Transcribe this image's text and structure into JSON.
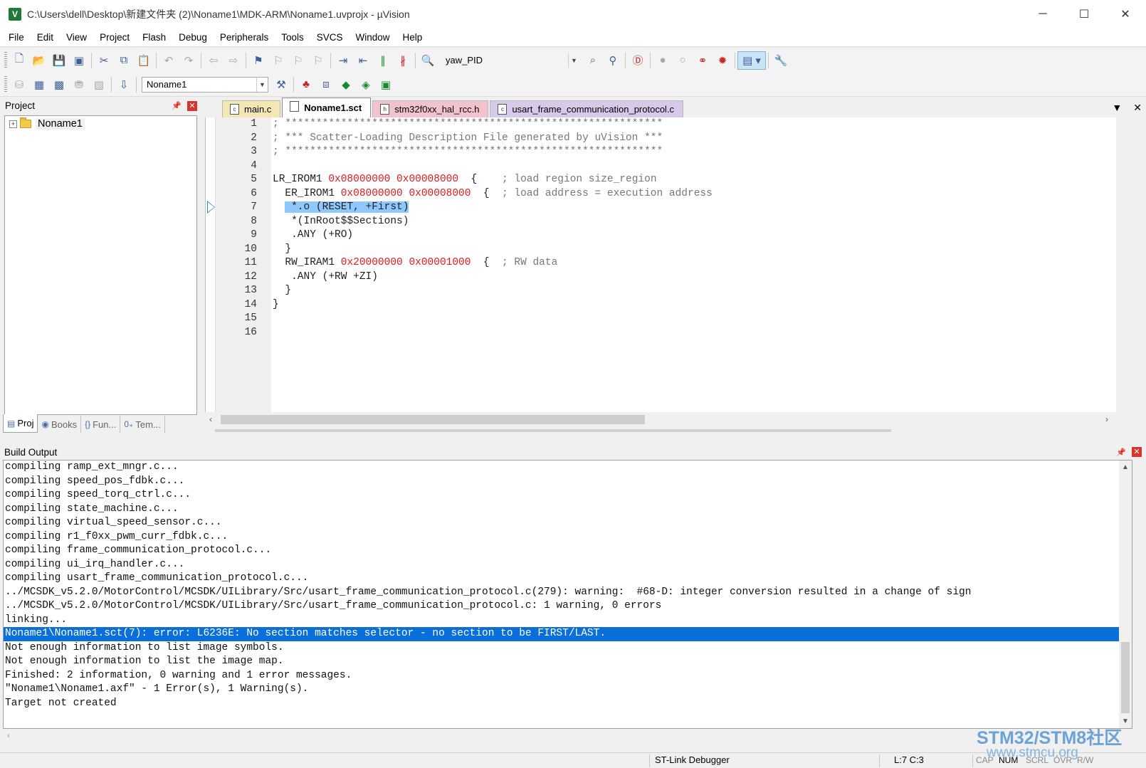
{
  "window": {
    "title": "C:\\Users\\dell\\Desktop\\新建文件夹 (2)\\Noname1\\MDK-ARM\\Noname1.uvprojx - µVision",
    "app_icon": "V",
    "controls": {
      "minimize": "─",
      "maximize": "☐",
      "close": "✕"
    }
  },
  "menu": [
    "File",
    "Edit",
    "View",
    "Project",
    "Flash",
    "Debug",
    "Peripherals",
    "Tools",
    "SVCS",
    "Window",
    "Help"
  ],
  "toolbar1": {
    "find_combo": "yaw_PID"
  },
  "toolbar2": {
    "target_combo": "Noname1"
  },
  "project_panel": {
    "title": "Project",
    "tree_root": "Noname1",
    "tabs": [
      {
        "icon": "▤",
        "label": "Proj"
      },
      {
        "icon": "◉",
        "label": "Books"
      },
      {
        "icon": "{}",
        "label": "Fun..."
      },
      {
        "icon": "0₊",
        "label": "Tem..."
      }
    ]
  },
  "editor": {
    "tabs": [
      {
        "label": "main.c",
        "kind": "c"
      },
      {
        "label": "Noname1.sct",
        "kind": "sct",
        "active": true
      },
      {
        "label": "stm32f0xx_hal_rcc.h",
        "kind": "h"
      },
      {
        "label": "usart_frame_communication_protocol.c",
        "kind": "proto"
      }
    ],
    "line_numbers": [
      "1",
      "2",
      "3",
      "4",
      "5",
      "6",
      "7",
      "8",
      "9",
      "10",
      "11",
      "12",
      "13",
      "14",
      "15",
      "16"
    ],
    "code": {
      "l1": "; *************************************************************",
      "l2": "; *** Scatter-Loading Description File generated by uVision ***",
      "l3": "; *************************************************************",
      "l5a": "LR_IROM1 ",
      "l5b": "0x08000000",
      "l5c": " ",
      "l5d": "0x00008000",
      "l5e": "  {    ",
      "l5f": "; load region size_region",
      "l6a": "  ER_IROM1 ",
      "l6b": "0x08000000",
      "l6c": " ",
      "l6d": "0x00008000",
      "l6e": "  {  ",
      "l6f": "; load address = execution address",
      "l7a": "  ",
      "l7b": " *.o (RESET, +First)",
      "l8": "   *(InRoot$$Sections)",
      "l9": "   .ANY (+RO)",
      "l10": "  }",
      "l11a": "  RW_IRAM1 ",
      "l11b": "0x20000000",
      "l11c": " ",
      "l11d": "0x00001000",
      "l11e": "  {  ",
      "l11f": "; RW data",
      "l12": "   .ANY (+RW +ZI)",
      "l13": "  }",
      "l14": "}"
    }
  },
  "build_output": {
    "title": "Build Output",
    "lines": [
      "compiling ramp_ext_mngr.c...",
      "compiling speed_pos_fdbk.c...",
      "compiling speed_torq_ctrl.c...",
      "compiling state_machine.c...",
      "compiling virtual_speed_sensor.c...",
      "compiling r1_f0xx_pwm_curr_fdbk.c...",
      "compiling frame_communication_protocol.c...",
      "compiling ui_irq_handler.c...",
      "compiling usart_frame_communication_protocol.c...",
      "../MCSDK_v5.2.0/MotorControl/MCSDK/UILibrary/Src/usart_frame_communication_protocol.c(279): warning:  #68-D: integer conversion resulted in a change of sign",
      "../MCSDK_v5.2.0/MotorControl/MCSDK/UILibrary/Src/usart_frame_communication_protocol.c: 1 warning, 0 errors",
      "linking...",
      "Noname1\\Noname1.sct(7): error: L6236E: No section matches selector - no section to be FIRST/LAST.",
      "Not enough information to list image symbols.",
      "Not enough information to list the image map.",
      "Finished: 2 information, 0 warning and 1 error messages.",
      "\"Noname1\\Noname1.axf\" - 1 Error(s), 1 Warning(s).",
      "Target not created"
    ],
    "selected_index": 12
  },
  "statusbar": {
    "debugger": "ST-Link Debugger",
    "position": "L:7 C:3",
    "locks": [
      "CAP",
      "NUM",
      "SCRL",
      "OVR",
      "R/W"
    ],
    "active_lock": "NUM"
  },
  "watermark": {
    "line1": "STM32/STM8社区",
    "line2": "www.stmcu.org"
  },
  "colors": {
    "hex_literal": "#e0191e",
    "selection": "#0a6fd8",
    "code_highlight": "#8fc8ff"
  }
}
